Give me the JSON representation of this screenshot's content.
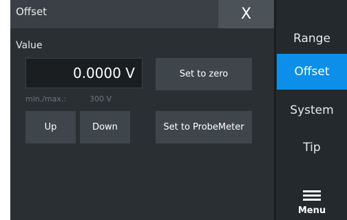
{
  "dialog": {
    "title": "Offset",
    "close_label": "X",
    "value_label": "Value",
    "value": "0.0000 V",
    "minmax_label": "min./max.:",
    "minmax_value": "300 V",
    "buttons": {
      "up": "Up",
      "down": "Down",
      "set_to_zero": "Set to zero",
      "set_to_probemeter": "Set to ProbeMeter"
    }
  },
  "sidemenu": {
    "items": [
      {
        "label": "Range",
        "active": false
      },
      {
        "label": "Offset",
        "active": true
      },
      {
        "label": "System",
        "active": false
      },
      {
        "label": "Tip",
        "active": false
      }
    ],
    "menu_label": "Menu"
  },
  "colors": {
    "accent": "#0b8fe8",
    "background": "#24292d",
    "button": "#3e464c"
  }
}
